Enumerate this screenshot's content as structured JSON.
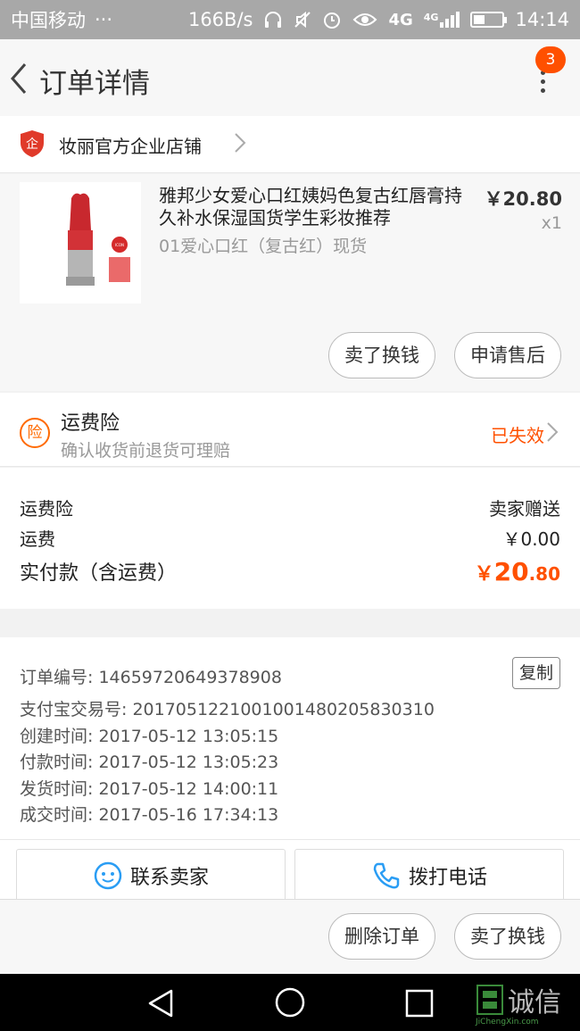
{
  "status_bar": {
    "carrier": "中国移动",
    "dots": "···",
    "speed": "166B/s",
    "network_a": "4G",
    "network_b": "4G",
    "time": "14:14",
    "battery_level": 0.4
  },
  "header": {
    "title": "订单详情",
    "notification_count": "3"
  },
  "shop": {
    "name": "妆丽官方企业店铺",
    "badge_text": "企"
  },
  "product": {
    "title": "雅邦少女爱心口红姨妈色复古红唇膏持久补水保湿国货学生彩妆推荐",
    "sku": "01爱心口红（复古红）现货",
    "price": "￥20.80",
    "quantity": "x1",
    "thumb_label": "ICON",
    "resell_label": "卖了换钱",
    "after_sale_label": "申请售后"
  },
  "insurance": {
    "icon_char": "险",
    "title": "运费险",
    "desc": "确认收货前退货可理赔",
    "status": "已失效"
  },
  "fees": {
    "insurance_label": "运费险",
    "insurance_value": "卖家赠送",
    "shipping_label": "运费",
    "shipping_value": "￥0.00",
    "total_label": "实付款（含运费）",
    "total_currency": "￥",
    "total_integer": "20",
    "total_decimal": ".80"
  },
  "order_info": {
    "order_no": "订单编号: 14659720649378908",
    "alipay_no": "支付宝交易号: 2017051221001001480205830310",
    "created": "创建时间: 2017-05-12 13:05:15",
    "paid": "付款时间: 2017-05-12 13:05:23",
    "shipped": "发货时间: 2017-05-12 14:00:11",
    "completed": "成交时间: 2017-05-16 17:34:13",
    "copy_label": "复制"
  },
  "contact": {
    "chat_label": "联系卖家",
    "call_label": "拨打电话"
  },
  "actions": {
    "delete_label": "删除订单",
    "resell_label": "卖了换钱"
  },
  "watermark": {
    "text": "诚信",
    "url": "JiChengXin.com"
  },
  "colors": {
    "accent": "#ff5000",
    "status_bar": "#a8a8a8",
    "nav_bar": "#000000"
  }
}
